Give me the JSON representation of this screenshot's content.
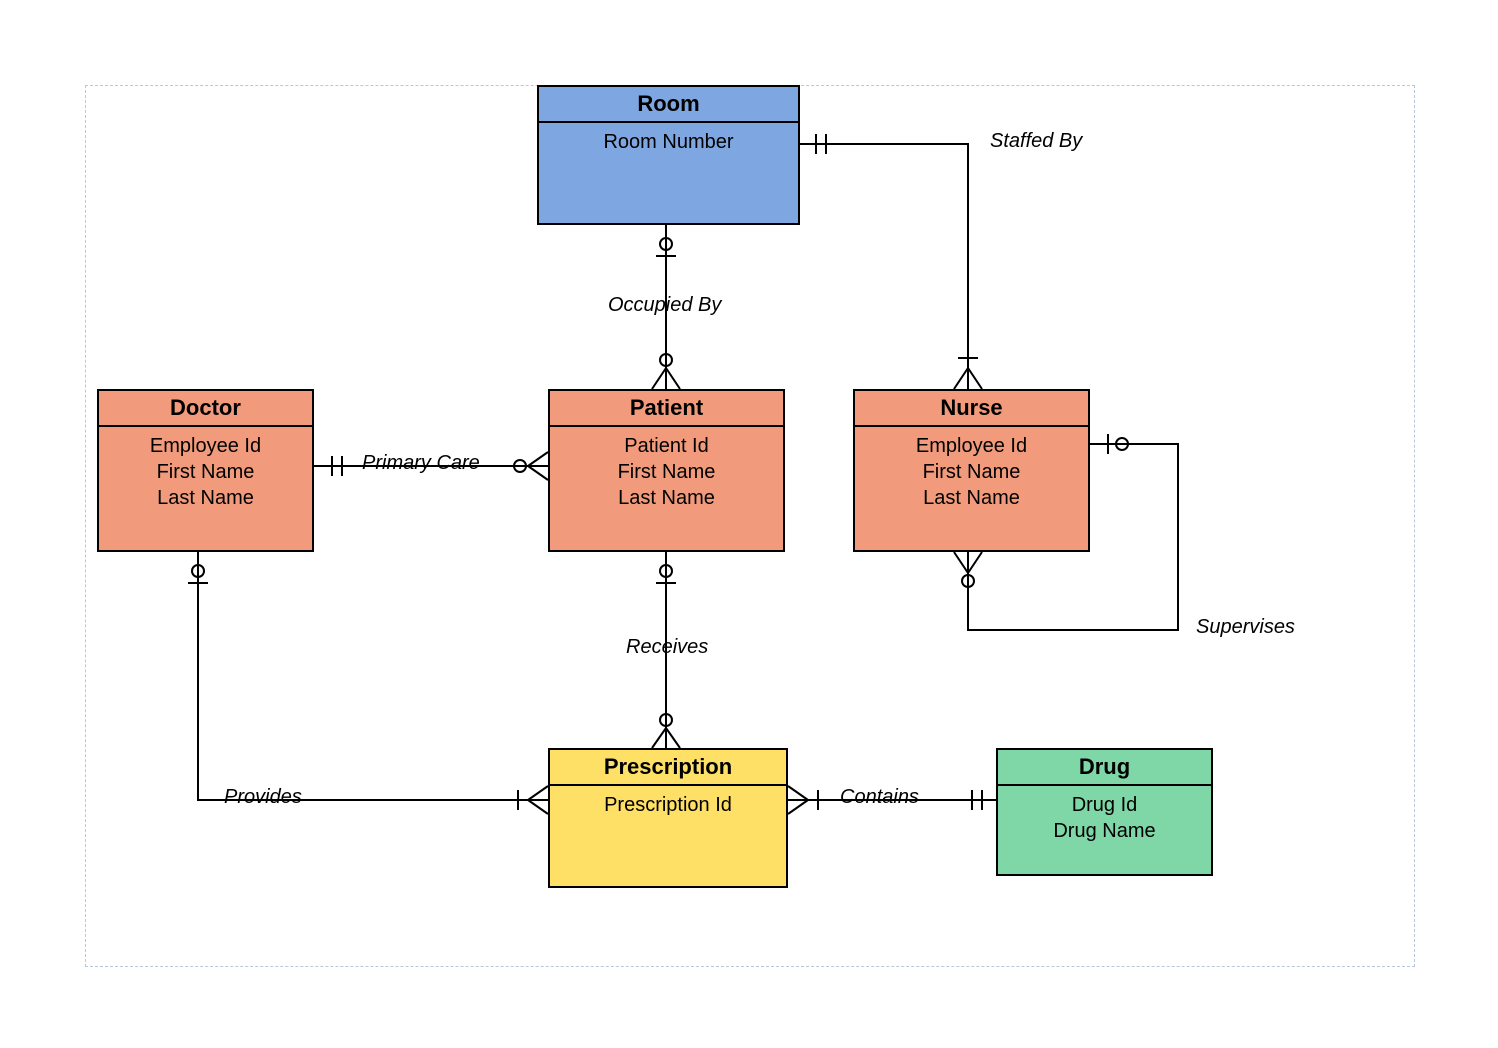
{
  "entities": {
    "room": {
      "title": "Room",
      "attrs": [
        "Room Number"
      ]
    },
    "doctor": {
      "title": "Doctor",
      "attrs": [
        "Employee Id",
        "First Name",
        "Last Name"
      ]
    },
    "patient": {
      "title": "Patient",
      "attrs": [
        "Patient Id",
        "First Name",
        "Last Name"
      ]
    },
    "nurse": {
      "title": "Nurse",
      "attrs": [
        "Employee Id",
        "First Name",
        "Last Name"
      ]
    },
    "prescription": {
      "title": "Prescription",
      "attrs": [
        "Prescription Id"
      ]
    },
    "drug": {
      "title": "Drug",
      "attrs": [
        "Drug Id",
        "Drug Name"
      ]
    }
  },
  "relationships": {
    "staffed_by": "Staffed By",
    "occupied_by": "Occupied By",
    "primary_care": "Primary Care",
    "receives": "Receives",
    "provides": "Provides",
    "contains": "Contains",
    "supervises": "Supervises"
  },
  "colors": {
    "room": "#7ea6e0",
    "person": "#f19b7c",
    "rx": "#ffe066",
    "drug": "#7fd6a6"
  }
}
